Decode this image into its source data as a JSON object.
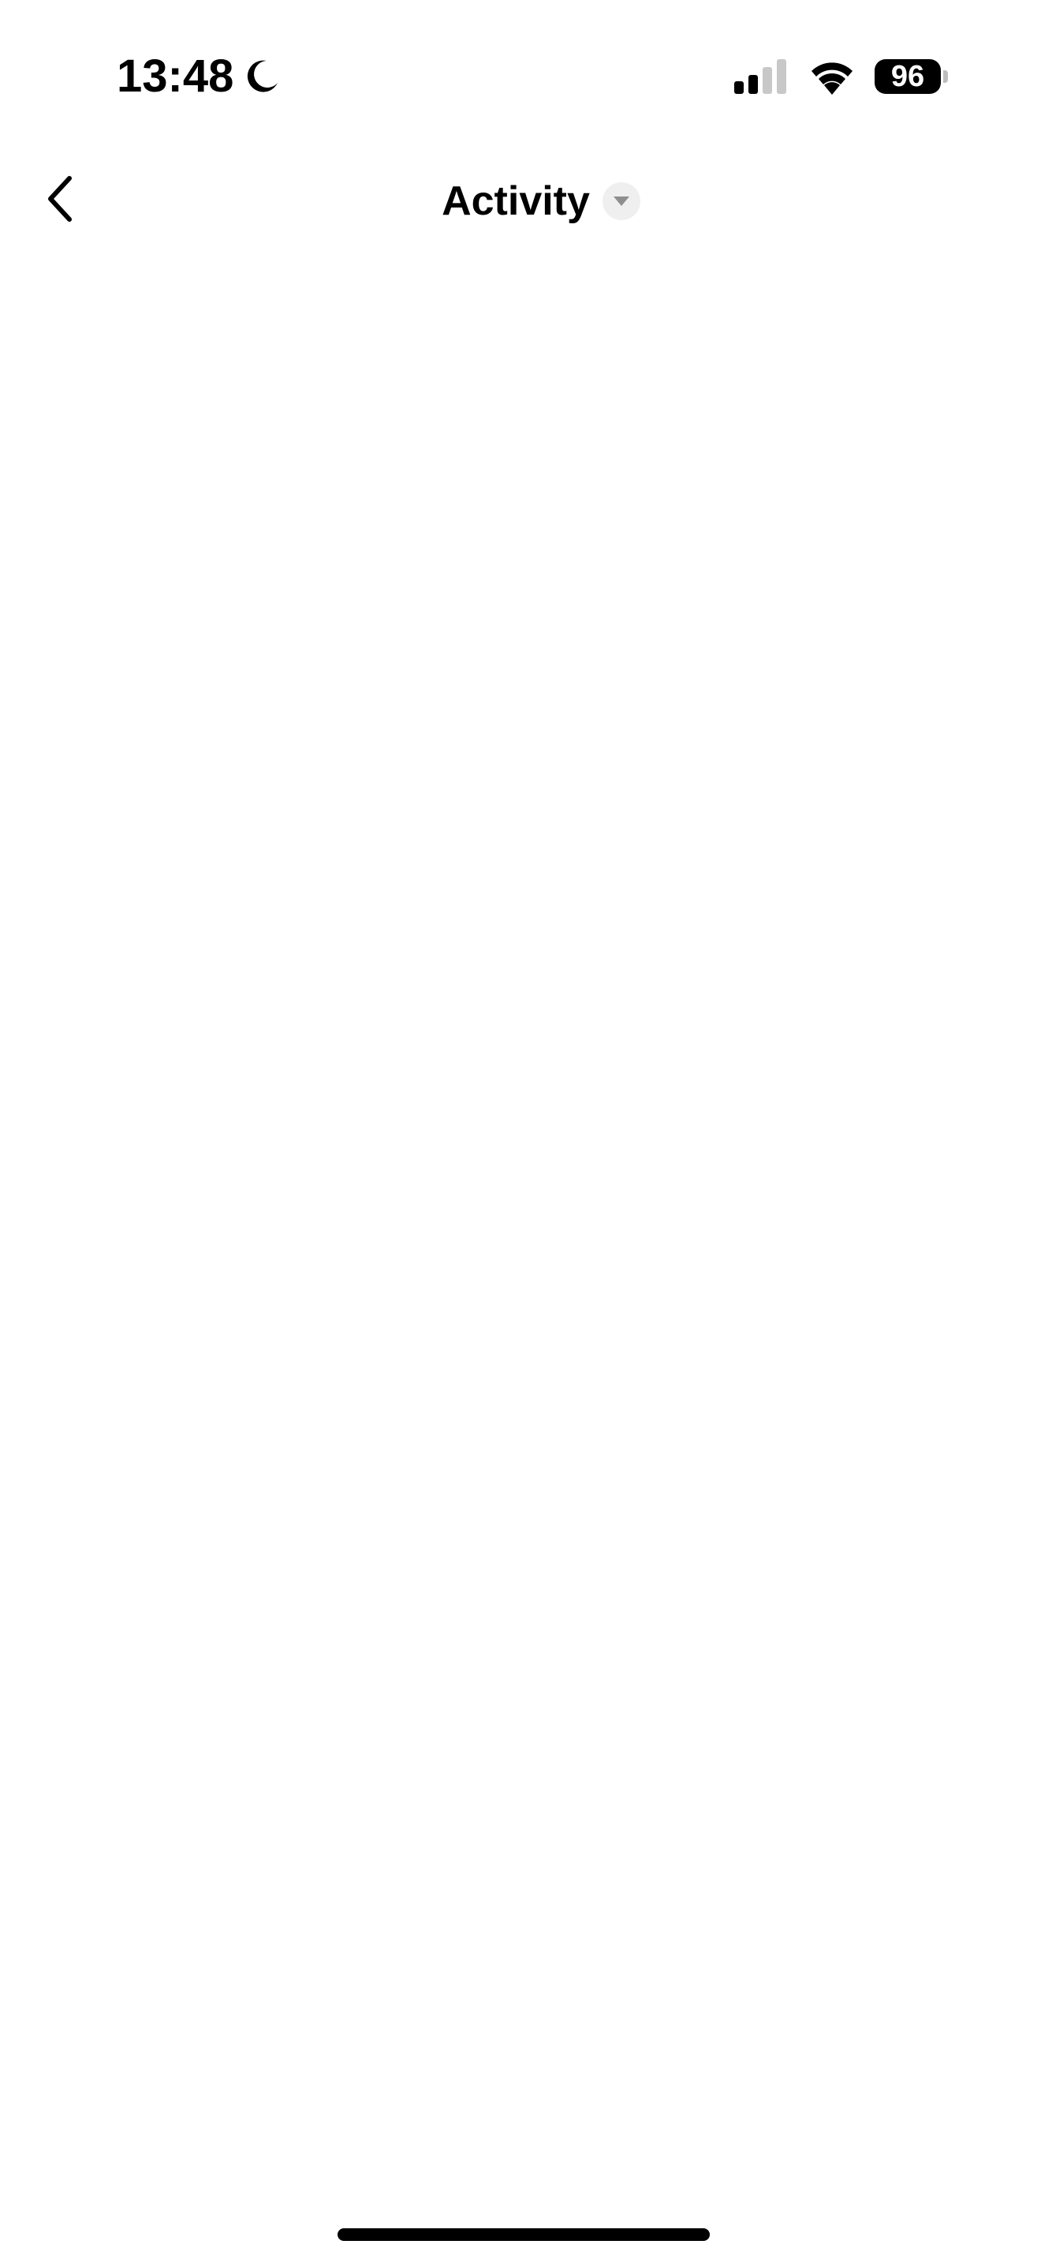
{
  "status_bar": {
    "time": "13:48",
    "focus_icon": "moon-icon",
    "signal_icon": "cellular-signal-icon",
    "signal_bars_active": 2,
    "signal_bars_total": 4,
    "wifi_icon": "wifi-icon",
    "battery_level": "96"
  },
  "header": {
    "back_icon": "chevron-left-icon",
    "title": "Activity",
    "dropdown_icon": "caret-down-icon"
  },
  "colors": {
    "background": "#ffffff",
    "text": "#000000",
    "dropdown_circle": "#efefef",
    "dropdown_caret": "#8e8e8e"
  }
}
